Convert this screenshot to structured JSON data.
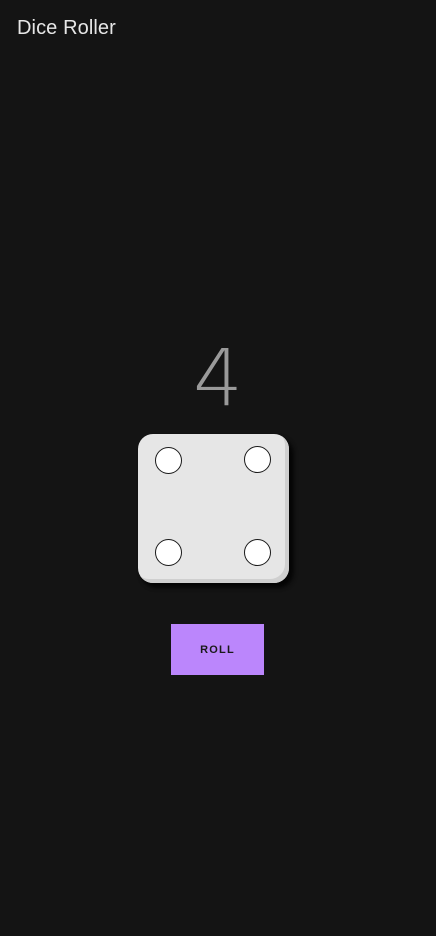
{
  "app_bar": {
    "title": "Dice Roller"
  },
  "result": {
    "value": "4"
  },
  "die": {
    "face_value": 4,
    "face_color": "#e6e6e6",
    "pip_color": "#ffffff"
  },
  "roll_button": {
    "label": "ROLL",
    "color": "#bb86fc"
  },
  "theme": {
    "background": "#141414"
  }
}
